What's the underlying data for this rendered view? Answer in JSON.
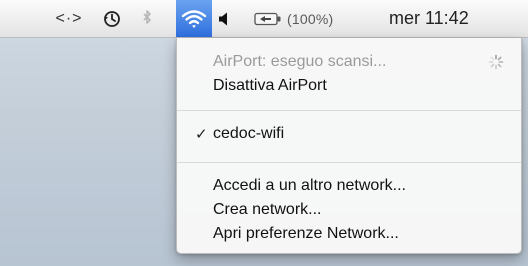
{
  "menubar": {
    "arrows_icon": "<·>",
    "time_machine_icon": "clock-history-icon",
    "bluetooth_icon": "bluetooth-icon",
    "wifi_icon": "wifi-icon",
    "volume_icon": "volume-icon",
    "battery_icon": "battery-charging-icon",
    "battery_text": "(100%)",
    "datetime": "mer 11:42",
    "wifi_highlight_color": "#3a7be6"
  },
  "airport_menu": {
    "status": "AirPort: eseguo scansi...",
    "toggle": "Disattiva AirPort",
    "networks": [
      {
        "name": "cedoc-wifi",
        "checkmark": "✓",
        "selected": true
      }
    ],
    "join_other": "Accedi a un altro network...",
    "create": "Crea network...",
    "open_prefs": "Apri preferenze Network..."
  }
}
